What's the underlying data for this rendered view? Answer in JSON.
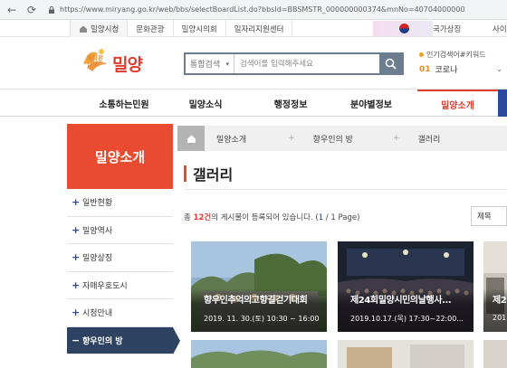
{
  "browser": {
    "url": "https://www.miryang.go.kr/web/bbs/selectBoardList.do?bbsId=BBSMSTR_000000000374&mnNo=40704000000"
  },
  "util_bar": {
    "tabs": [
      "밀양시청",
      "문화관광",
      "밀양시의회",
      "일자리지원센터"
    ],
    "national_symbol": "국가상징",
    "site_link": "사이"
  },
  "header": {
    "logo_slogan": "해맑은 상상",
    "logo_text": "밀양",
    "search": {
      "category": "통합검색",
      "placeholder": "검색어를 입력해주세요"
    },
    "popular": {
      "title": "인기검색어#키워드",
      "rank": "01",
      "keyword": "코로나"
    }
  },
  "gnb": {
    "items": [
      "소통하는민원",
      "밀양소식",
      "행정정보",
      "분야별정보",
      "밀양소개"
    ],
    "active_index": 4
  },
  "sidebar": {
    "title": "밀양소개",
    "items": [
      {
        "label": "일반현황",
        "marker": "+"
      },
      {
        "label": "밀양역사",
        "marker": "+"
      },
      {
        "label": "밀양상징",
        "marker": "+"
      },
      {
        "label": "자매우호도시",
        "marker": "+"
      },
      {
        "label": "시청안내",
        "marker": "+"
      },
      {
        "label": "향우인의 방",
        "marker": "−"
      }
    ],
    "active_index": 5
  },
  "breadcrumb": {
    "items": [
      "밀양소개",
      "향우인의 방",
      "갤러리"
    ],
    "separator": "+"
  },
  "content": {
    "title": "갤러리",
    "info_total_prefix": "총 ",
    "info_count": "12건",
    "info_mid": "의 게시물이 등록되어 있습니다. (",
    "info_page_current": "1",
    "info_page_suffix": " / 1 Page)",
    "sort_label": "제목",
    "gallery": [
      {
        "title": "향우인추억의고향길걷기대회",
        "date": "2019. 11. 30.(토) 10:30 ~ 16:00"
      },
      {
        "title": "제24회밀양시민의날행사...",
        "date": "2019.10.17.(목) 17:30~22:00..."
      },
      {
        "title": "제2",
        "date": "201"
      }
    ]
  },
  "colors": {
    "accent_red": "#e23b2f",
    "side_head": "#e84b30",
    "side_active": "#2e4262",
    "search_border": "#6b7d8e"
  }
}
